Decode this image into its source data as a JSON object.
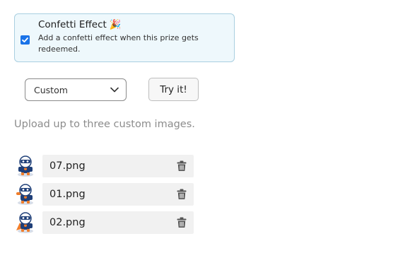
{
  "confetti": {
    "title": "Confetti Effect",
    "emoji": "🎉",
    "description": "Add a confetti effect when this prize gets redeemed.",
    "checked": true,
    "accent_color": "#1a73e8"
  },
  "select": {
    "value": "Custom",
    "icon": "chevron-down-icon"
  },
  "try_button": {
    "label": "Try it!"
  },
  "upload": {
    "text": "Upload up to three custom images."
  },
  "images": [
    {
      "filename": "07.png",
      "icon": "trash-icon"
    },
    {
      "filename": "01.png",
      "icon": "trash-icon"
    },
    {
      "filename": "02.png",
      "icon": "trash-icon"
    }
  ]
}
